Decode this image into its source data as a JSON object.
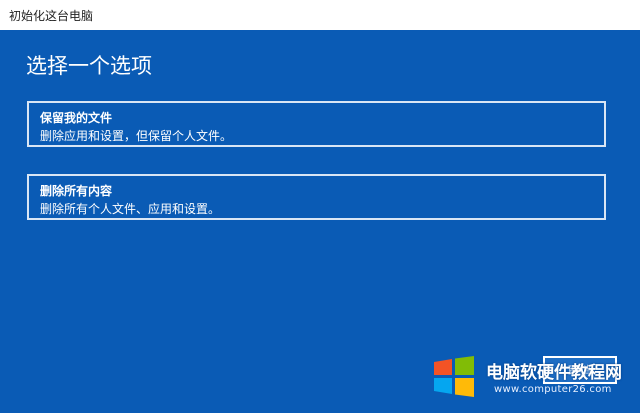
{
  "window": {
    "title": "初始化这台电脑"
  },
  "main": {
    "heading": "选择一个选项",
    "options": [
      {
        "title": "保留我的文件",
        "description": "删除应用和设置，但保留个人文件。"
      },
      {
        "title": "删除所有内容",
        "description": "删除所有个人文件、应用和设置。"
      }
    ],
    "cancel_label": "取消"
  },
  "watermark": {
    "text": "电脑软硬件教程网",
    "url": "www.computer26.com"
  },
  "colors": {
    "background": "#0a5bb5",
    "option_border": "#d9e6f5",
    "text": "#ffffff"
  }
}
